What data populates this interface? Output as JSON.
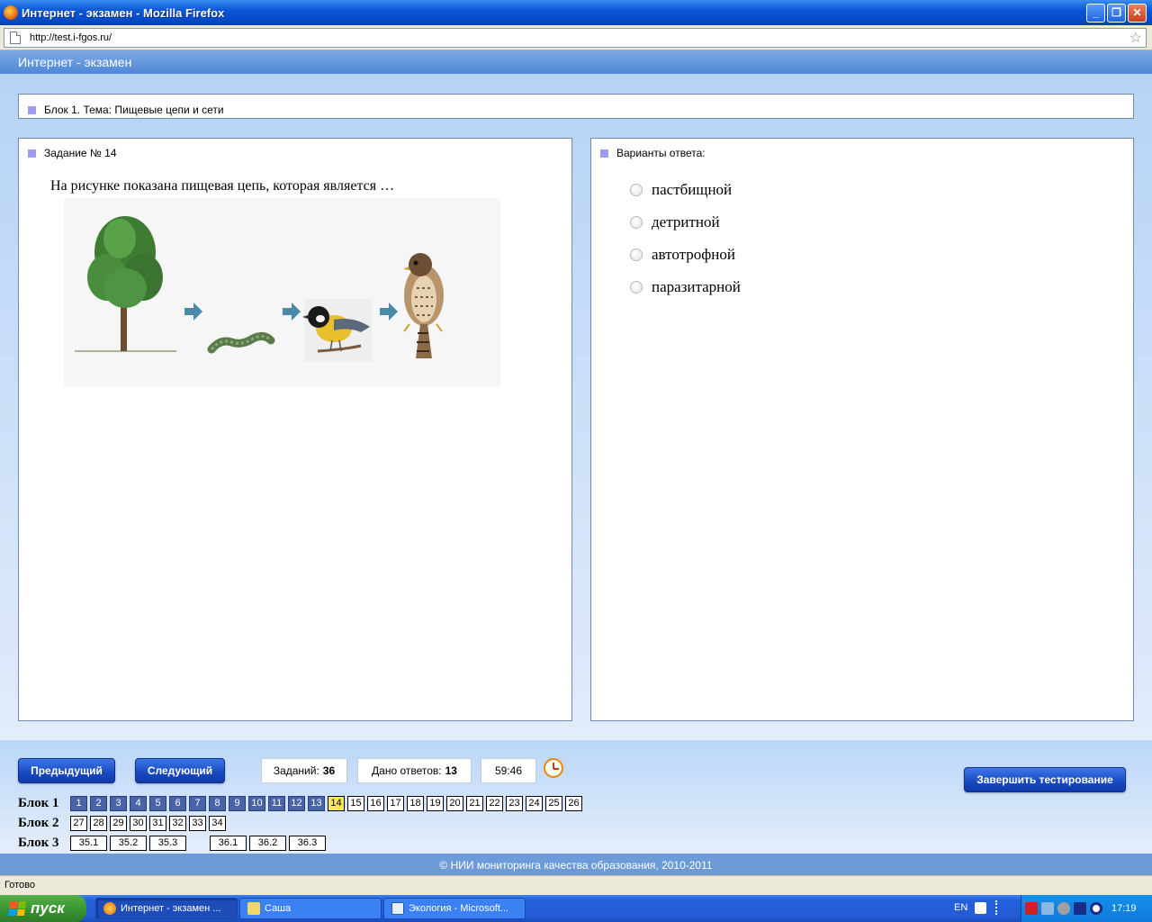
{
  "window": {
    "title": "Интернет - экзамен - Mozilla Firefox",
    "minimize": "_",
    "maximize": "❐",
    "close": "✕"
  },
  "address": {
    "url": "http://test.i-fgos.ru/"
  },
  "app": {
    "header": "Интернет - экзамен"
  },
  "block_bar": {
    "label": "Блок 1. Тема: Пищевые цепи и сети"
  },
  "task": {
    "title": "Задание № 14",
    "question": "На рисунке показана пищевая цепь, которая является …"
  },
  "answers": {
    "title": "Варианты ответа:",
    "options": [
      "пастбищной",
      "детритной",
      "автотрофной",
      "паразитарной"
    ]
  },
  "controls": {
    "prev": "Предыдущий",
    "next": "Следующий",
    "tasks_label": "Заданий:",
    "tasks_value": "36",
    "answered_label": "Дано ответов:",
    "answered_value": "13",
    "timer": "59:46",
    "finish": "Завершить тестирование"
  },
  "blocks": [
    {
      "label": "Блок 1",
      "items": [
        "1",
        "2",
        "3",
        "4",
        "5",
        "6",
        "7",
        "8",
        "9",
        "10",
        "11",
        "12",
        "13",
        "14",
        "15",
        "16",
        "17",
        "18",
        "19",
        "20",
        "21",
        "22",
        "23",
        "24",
        "25",
        "26"
      ]
    },
    {
      "label": "Блок 2",
      "items": [
        "27",
        "28",
        "29",
        "30",
        "31",
        "32",
        "33",
        "34"
      ]
    },
    {
      "label": "Блок 3",
      "items": [
        "35.1",
        "35.2",
        "35.3",
        "36.1",
        "36.2",
        "36.3"
      ]
    }
  ],
  "answered_items": [
    "1",
    "2",
    "3",
    "4",
    "5",
    "6",
    "7",
    "8",
    "9",
    "10",
    "11",
    "12",
    "13"
  ],
  "current_item": "14",
  "footer": "© НИИ мониторинга качества образования, 2010-2011",
  "status": "Готово",
  "taskbar": {
    "start": "пуск",
    "tasks": [
      "Интернет - экзамен ...",
      "Саша",
      "Экология - Microsoft..."
    ],
    "lang": "EN",
    "clock": "17:19"
  }
}
